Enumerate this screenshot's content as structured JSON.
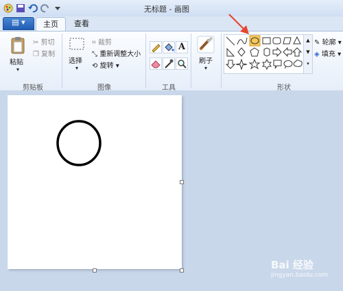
{
  "window": {
    "title": "无标题 - 画图"
  },
  "tabs": {
    "menu": "▤ ▾",
    "home": "主页",
    "view": "查看"
  },
  "groups": {
    "clipboard": {
      "label": "剪贴板",
      "paste": "粘贴",
      "cut": "剪切",
      "copy": "复制"
    },
    "image": {
      "label": "图像",
      "select": "选择",
      "crop": "裁剪",
      "resize": "重新调整大小",
      "rotate": "旋转"
    },
    "tools": {
      "label": "工具"
    },
    "brushes": {
      "label": "刷子"
    },
    "shapes": {
      "label": "形状",
      "outline": "轮廓",
      "fill": "填充"
    }
  },
  "colors": {
    "accent": "#e5472e",
    "selected_shape": "#f7c85a",
    "ribbon_tab": "#1f5db6"
  },
  "watermark": {
    "brand": "Bai 经验",
    "url": "jingyan.baidu.com"
  }
}
